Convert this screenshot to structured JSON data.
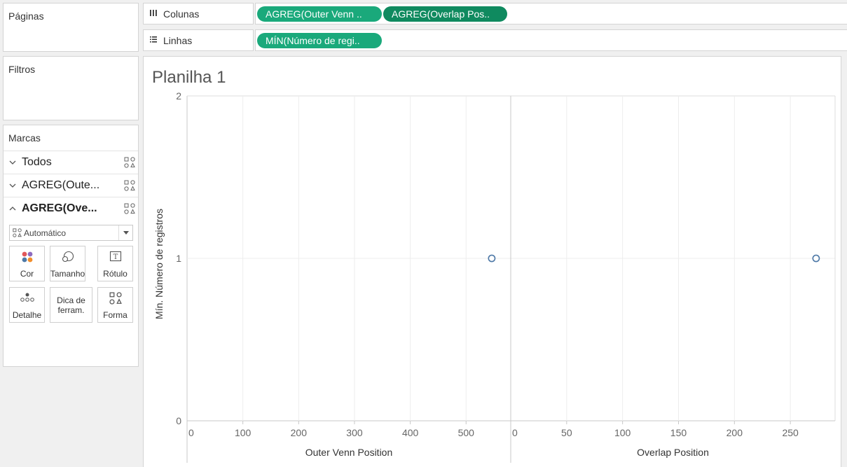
{
  "left_panels": {
    "paginas": "Páginas",
    "filtros": "Filtros",
    "marcas": "Marcas"
  },
  "marks": {
    "rows": [
      {
        "label": "Todos",
        "chevron": "chevron-down",
        "bold": false
      },
      {
        "label": "AGREG(Oute...",
        "chevron": "chevron-down",
        "bold": false
      },
      {
        "label": "AGREG(Ove...",
        "chevron": "chevron-up",
        "bold": true
      }
    ],
    "mark_type": "Automático",
    "buttons": {
      "cor": "Cor",
      "tamanho": "Tamanho",
      "rotulo": "Rótulo",
      "detalhe": "Detalhe",
      "dica_line1": "Dica de",
      "dica_line2": "ferram.",
      "forma": "Forma"
    },
    "colors": {
      "cor_dots": [
        "#e15759",
        "#8e6bbf",
        "#4e79a7",
        "#f28e2b"
      ]
    }
  },
  "shelves": {
    "colunas": {
      "label": "Colunas",
      "pills": [
        "AGREG(Outer Venn ..",
        "AGREG(Overlap Pos.."
      ]
    },
    "linhas": {
      "label": "Linhas",
      "pills": [
        "MÍN(Número de regi.."
      ]
    },
    "pill_colors": [
      "#1aa97b",
      "#0f8a5f"
    ]
  },
  "sheet_title": "Planilha 1",
  "chart_data": [
    {
      "type": "scatter",
      "xlabel": "Outer Venn Position",
      "ylabel": "Mín. Número de registros",
      "xlim": [
        0,
        580
      ],
      "ylim": [
        0,
        2
      ],
      "x_ticks": [
        0,
        100,
        200,
        300,
        400,
        500
      ],
      "y_ticks": [
        0,
        1,
        2
      ],
      "grid": true,
      "points": [
        {
          "x": 546,
          "y": 1
        }
      ],
      "marker": "open-circle",
      "marker_color": "#4e79a7"
    },
    {
      "type": "scatter",
      "xlabel": "Overlap Position",
      "ylabel": "Mín. Número de registros",
      "xlim": [
        0,
        290
      ],
      "ylim": [
        0,
        2
      ],
      "x_ticks": [
        0,
        50,
        100,
        150,
        200,
        250
      ],
      "y_ticks": [
        0,
        1,
        2
      ],
      "grid": true,
      "points": [
        {
          "x": 273,
          "y": 1
        }
      ],
      "marker": "open-circle",
      "marker_color": "#4e79a7"
    }
  ]
}
